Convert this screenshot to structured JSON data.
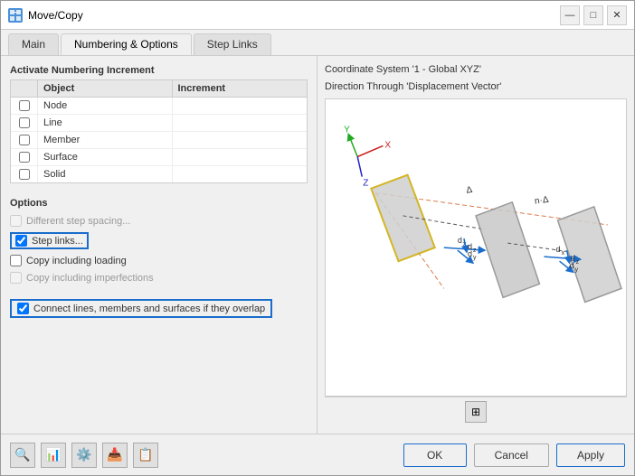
{
  "window": {
    "title": "Move/Copy",
    "icon_label": "MC"
  },
  "title_controls": {
    "minimize": "—",
    "maximize": "□",
    "close": "✕"
  },
  "tabs": [
    {
      "label": "Main",
      "active": false
    },
    {
      "label": "Numbering & Options",
      "active": true
    },
    {
      "label": "Step Links",
      "active": false
    }
  ],
  "numbering": {
    "section_title": "Activate Numbering Increment",
    "columns": [
      "Object",
      "Increment"
    ],
    "rows": [
      {
        "object": "Node",
        "checked": false
      },
      {
        "object": "Line",
        "checked": false
      },
      {
        "object": "Member",
        "checked": false
      },
      {
        "object": "Surface",
        "checked": false
      },
      {
        "object": "Solid",
        "checked": false
      }
    ]
  },
  "options": {
    "section_title": "Options",
    "items": [
      {
        "label": "Different step spacing...",
        "checked": false,
        "disabled": true,
        "highlighted": false
      },
      {
        "label": "Step links...",
        "checked": true,
        "disabled": false,
        "highlighted": true
      },
      {
        "label": "Copy including loading",
        "checked": false,
        "disabled": false,
        "highlighted": false
      },
      {
        "label": "Copy including imperfections",
        "checked": false,
        "disabled": true,
        "highlighted": false
      }
    ],
    "connect_label": "Connect lines, members and surfaces if they overlap",
    "connect_checked": true
  },
  "diagram": {
    "coord_line1": "Coordinate System '1 - Global XYZ'",
    "coord_line2": "Direction Through 'Displacement Vector'"
  },
  "footer": {
    "icons": [
      "🔍",
      "📊",
      "⚙️",
      "📥",
      "📋"
    ],
    "buttons": {
      "ok": "OK",
      "cancel": "Cancel",
      "apply": "Apply"
    }
  }
}
